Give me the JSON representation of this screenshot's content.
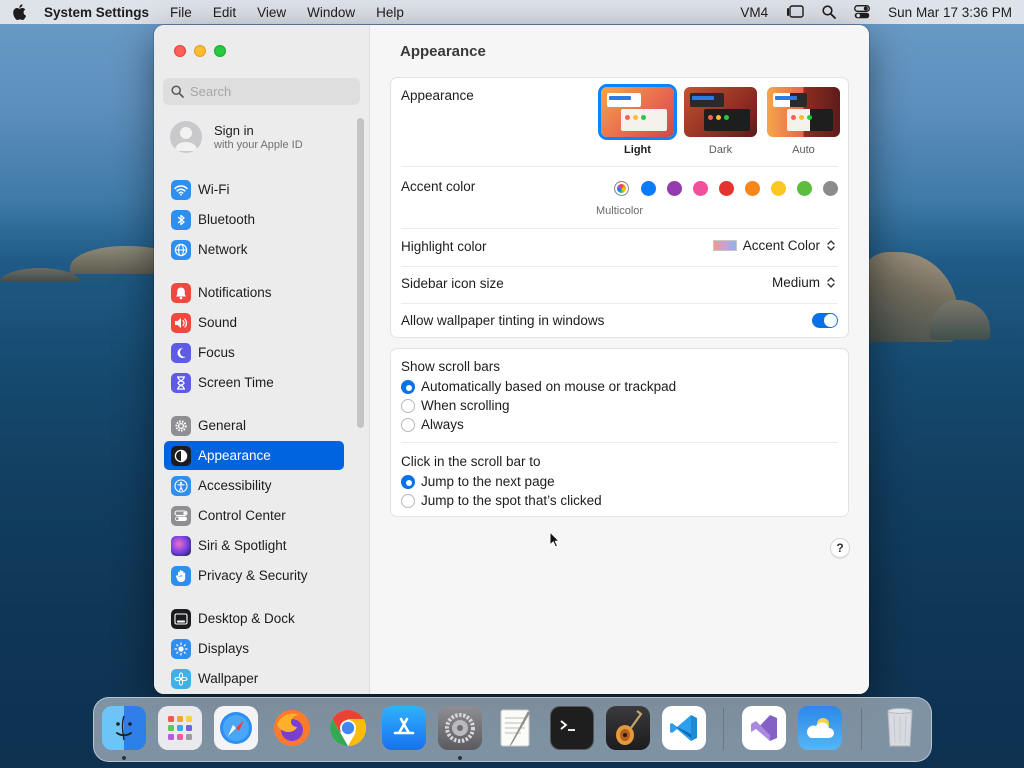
{
  "menubar": {
    "app_name": "System Settings",
    "menus": [
      "File",
      "Edit",
      "View",
      "Window",
      "Help"
    ],
    "status": {
      "vm": "VM4",
      "clock": "Sun Mar 17  3:36 PM"
    }
  },
  "sidebar": {
    "search_placeholder": "Search",
    "signin": {
      "title": "Sign in",
      "subtitle": "with your Apple ID"
    },
    "items": [
      {
        "label": "Wi-Fi",
        "icon": "wifi-icon",
        "color": "#2f8ff0"
      },
      {
        "label": "Bluetooth",
        "icon": "bluetooth-icon",
        "color": "#2f8ff0"
      },
      {
        "label": "Network",
        "icon": "globe-icon",
        "color": "#2f8ff0"
      },
      {
        "label": "Notifications",
        "icon": "bell-icon",
        "color": "#f0473e"
      },
      {
        "label": "Sound",
        "icon": "speaker-icon",
        "color": "#f0473e"
      },
      {
        "label": "Focus",
        "icon": "moon-icon",
        "color": "#5e5ce6"
      },
      {
        "label": "Screen Time",
        "icon": "hourglass-icon",
        "color": "#5e5ce6"
      },
      {
        "label": "General",
        "icon": "gear-icon",
        "color": "#8e8e93"
      },
      {
        "label": "Appearance",
        "icon": "appearance-icon",
        "color": "#1c1c1e"
      },
      {
        "label": "Accessibility",
        "icon": "accessibility-icon",
        "color": "#2f8ff0"
      },
      {
        "label": "Control Center",
        "icon": "control-center-icon",
        "color": "#8e8e93"
      },
      {
        "label": "Siri & Spotlight",
        "icon": "siri-icon",
        "color": "#b03cc8"
      },
      {
        "label": "Privacy & Security",
        "icon": "hand-icon",
        "color": "#2f8ff0"
      },
      {
        "label": "Desktop & Dock",
        "icon": "dock-icon",
        "color": "#1c1c1e"
      },
      {
        "label": "Displays",
        "icon": "sun-icon",
        "color": "#2f8ff0"
      },
      {
        "label": "Wallpaper",
        "icon": "flower-icon",
        "color": "#3fb0e8"
      }
    ],
    "selected": "Appearance"
  },
  "main": {
    "title": "Appearance",
    "appearance": {
      "label": "Appearance",
      "options": [
        "Light",
        "Dark",
        "Auto"
      ],
      "selected": "Light"
    },
    "accent": {
      "label": "Accent color",
      "selected_caption": "Multicolor",
      "colors": [
        "#ff3b30",
        "#0a7aff",
        "#953bb0",
        "#f0519c",
        "#e3342f",
        "#f68619",
        "#fbc724",
        "#5dbd3f",
        "#8c8c8c"
      ]
    },
    "highlight": {
      "label": "Highlight color",
      "value": "Accent Color"
    },
    "sidebar_icon_size": {
      "label": "Sidebar icon size",
      "value": "Medium"
    },
    "wallpaper_tinting": {
      "label": "Allow wallpaper tinting in windows",
      "enabled": true
    },
    "scroll_bars": {
      "label": "Show scroll bars",
      "options": [
        "Automatically based on mouse or trackpad",
        "When scrolling",
        "Always"
      ],
      "selected": "Automatically based on mouse or trackpad"
    },
    "scroll_click": {
      "label": "Click in the scroll bar to",
      "options": [
        "Jump to the next page",
        "Jump to the spot that’s clicked"
      ],
      "selected": "Jump to the next page"
    },
    "help": "?"
  },
  "dock": {
    "apps": [
      "Finder",
      "Launchpad",
      "Safari",
      "Firefox",
      "Chrome",
      "App Store",
      "System Settings",
      "TextEdit",
      "Terminal",
      "GarageBand",
      "VS Code",
      "Visual Studio",
      "Weather",
      "Trash"
    ]
  }
}
